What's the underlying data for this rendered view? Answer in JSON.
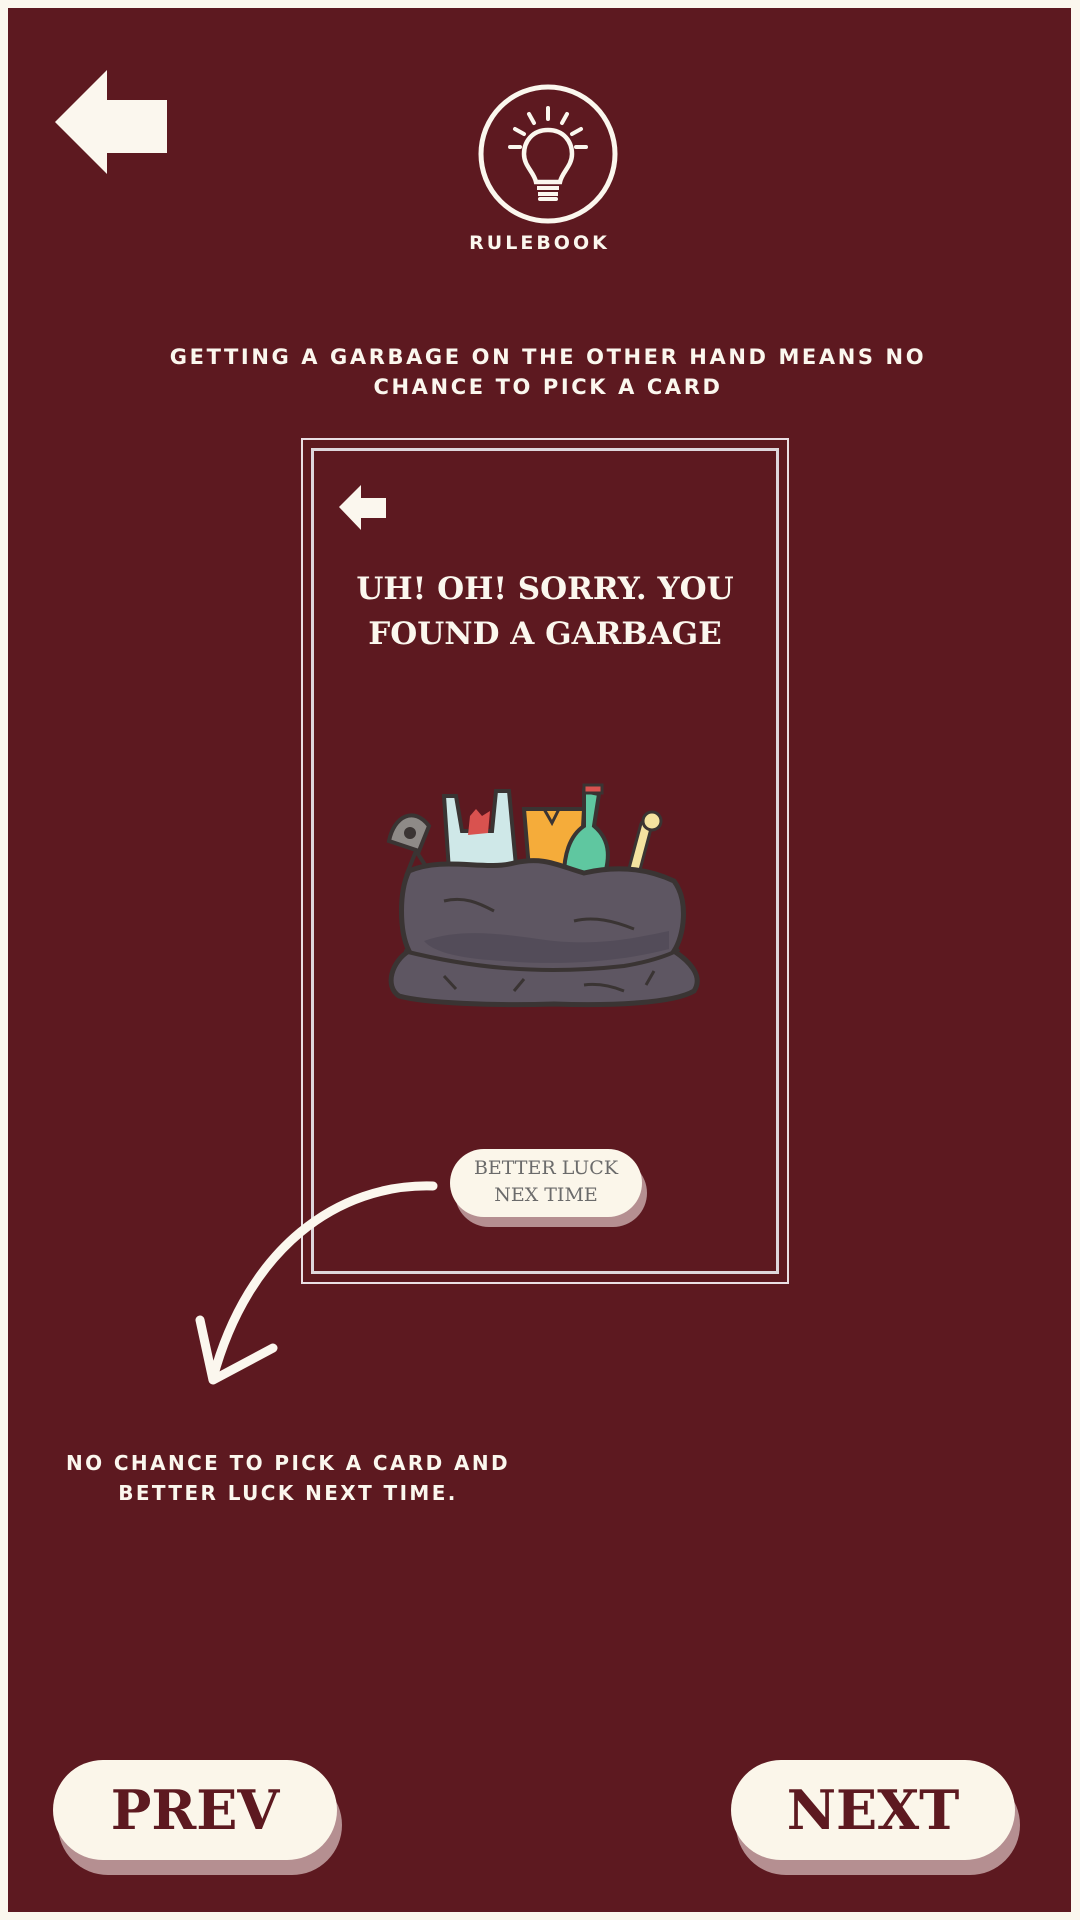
{
  "header": {
    "rulebook_label": "RULEBOOK",
    "back_icon": "back-arrow-icon",
    "rulebook_icon": "lightbulb-icon"
  },
  "instruction": "GETTING A GARBAGE ON THE OTHER HAND MEANS NO CHANCE TO PICK A CARD",
  "preview_card": {
    "title": "UH! OH! SORRY. YOU FOUND A GARBAGE",
    "button_label": "BETTER LUCK NEX TIME",
    "image": "garbage-bag-illustration"
  },
  "note": "NO CHANCE TO PICK A CARD AND BETTER LUCK NEXT TIME.",
  "nav": {
    "prev_label": "PREV",
    "next_label": "NEXT"
  },
  "colors": {
    "background": "#5d1920",
    "cream": "#fbf6ea",
    "button_shadow": "#b58f91"
  }
}
